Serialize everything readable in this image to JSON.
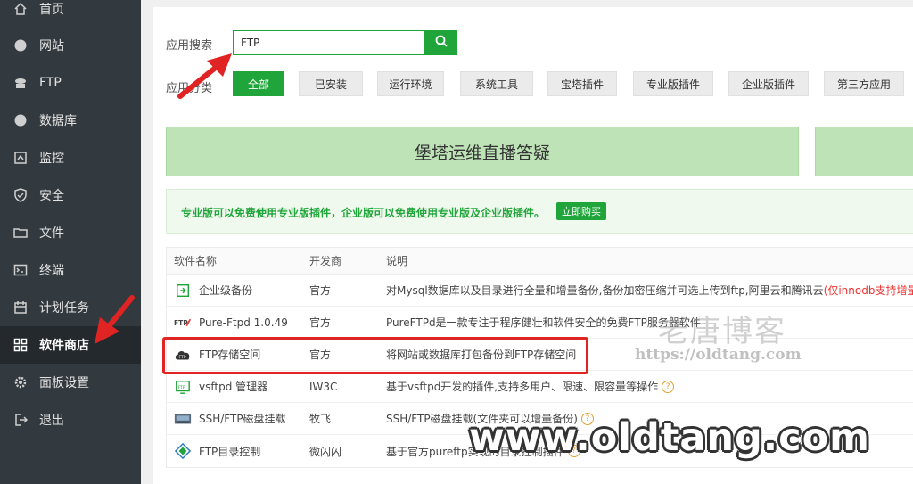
{
  "sidebar": {
    "items": [
      {
        "label": "首页",
        "icon": "home-icon"
      },
      {
        "label": "网站",
        "icon": "globe-icon"
      },
      {
        "label": "FTP",
        "icon": "ftp-icon"
      },
      {
        "label": "数据库",
        "icon": "database-icon"
      },
      {
        "label": "监控",
        "icon": "monitor-icon"
      },
      {
        "label": "安全",
        "icon": "shield-icon"
      },
      {
        "label": "文件",
        "icon": "folder-icon"
      },
      {
        "label": "终端",
        "icon": "terminal-icon"
      },
      {
        "label": "计划任务",
        "icon": "calendar-icon"
      },
      {
        "label": "软件商店",
        "icon": "grid-icon",
        "active": true
      },
      {
        "label": "面板设置",
        "icon": "gear-icon"
      },
      {
        "label": "退出",
        "icon": "logout-icon"
      }
    ]
  },
  "search": {
    "label": "应用搜索",
    "value": "FTP"
  },
  "category": {
    "label": "应用分类",
    "items": [
      "全部",
      "已安装",
      "运行环境",
      "系统工具",
      "宝塔插件",
      "专业版插件",
      "企业版插件",
      "第三方应用"
    ]
  },
  "banner": {
    "title": "堡塔运维直播答疑"
  },
  "notice": {
    "text": "专业版可以免费使用专业版插件，企业版可以免费使用专业版及企业版插件。",
    "button": "立即购买"
  },
  "table": {
    "headers": [
      "软件名称",
      "开发商",
      "说明"
    ],
    "rows": [
      {
        "name": "企业级备份",
        "dev": "官方",
        "desc": "对Mysql数据库以及目录进行全量和增量备份,备份加密压缩并可选上传到ftp,阿里云和腾讯云",
        "desc_extra": "(仅innodb支持增量备份) >",
        "icon": "backup-icon"
      },
      {
        "name": "Pure-Ftpd 1.0.49",
        "dev": "官方",
        "desc": "PureFTPd是一款专注于程序健壮和软件安全的免费FTP服务器软件",
        "icon": "ftp-logo-icon"
      },
      {
        "name": "FTP存储空间",
        "dev": "官方",
        "desc": "将网站或数据库打包备份到FTP存储空间",
        "icon": "cloud-ftp-icon"
      },
      {
        "name": "vsftpd 管理器",
        "dev": "IW3C",
        "desc": "基于vsftpd开发的插件,支持多用户、限速、限容量等操作",
        "help": "?",
        "icon": "vsftpd-icon"
      },
      {
        "name": "SSH/FTP磁盘挂载",
        "dev": "牧飞",
        "desc": "SSH/FTP磁盘挂载(文件夹可以增量备份)",
        "help": "?",
        "icon": "disk-mount-icon"
      },
      {
        "name": "FTP目录控制",
        "dev": "微闪闪",
        "desc": "基于官方pureftp实现的目录控制插件",
        "help": "?",
        "icon": "dir-control-icon"
      }
    ]
  },
  "watermark": {
    "cn": "老唐博客",
    "url": "https://oldtang.com",
    "big": "www.oldtang.com"
  },
  "colors": {
    "accent": "#20a53a",
    "sidebar_bg": "#333a3f",
    "highlight": "#e02323"
  }
}
